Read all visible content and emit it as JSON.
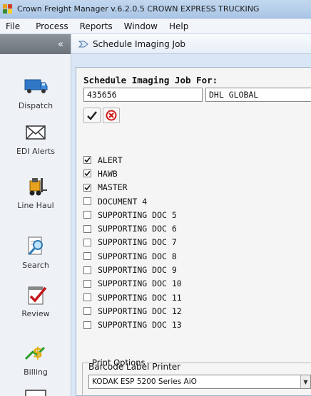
{
  "window": {
    "title": "Crown Freight Manager v.6.2.0.5 CROWN EXPRESS TRUCKING"
  },
  "menu": [
    "File",
    "Process",
    "Reports",
    "Window",
    "Help"
  ],
  "sidebar": {
    "collapse_glyph": "«",
    "items": [
      {
        "label": "Dispatch",
        "icon": "truck-icon"
      },
      {
        "label": "EDI Alerts",
        "icon": "envelope-icon"
      },
      {
        "label": "Line Haul",
        "icon": "forklift-icon"
      },
      {
        "label": "Search",
        "icon": "magnifier-document-icon"
      },
      {
        "label": "Review",
        "icon": "checkmark-document-icon"
      },
      {
        "label": "Billing",
        "icon": "dollar-icon"
      }
    ]
  },
  "tab": {
    "label": "Schedule Imaging Job"
  },
  "form": {
    "heading": "Schedule Imaging Job For:",
    "job_number": "435656",
    "customer": "DHL GLOBAL",
    "confirm_icon": "checkmark-icon",
    "cancel_icon": "cancel-icon"
  },
  "documents": [
    {
      "label": "ALERT",
      "checked": true
    },
    {
      "label": "HAWB",
      "checked": true
    },
    {
      "label": "MASTER",
      "checked": true
    },
    {
      "label": "DOCUMENT 4",
      "checked": false
    },
    {
      "label": "SUPPORTING DOC 5",
      "checked": false
    },
    {
      "label": "SUPPORTING DOC 6",
      "checked": false
    },
    {
      "label": "SUPPORTING DOC 7",
      "checked": false
    },
    {
      "label": "SUPPORTING DOC 8",
      "checked": false
    },
    {
      "label": "SUPPORTING DOC 9",
      "checked": false
    },
    {
      "label": "SUPPORTING DOC 10",
      "checked": false
    },
    {
      "label": "SUPPORTING DOC 11",
      "checked": false
    },
    {
      "label": "SUPPORTING DOC 12",
      "checked": false
    },
    {
      "label": "SUPPORTING DOC 13",
      "checked": false
    }
  ],
  "print_options": {
    "legend": "Print Options",
    "printer_label": "Barcode Label Printer",
    "printer_value": "KODAK ESP 5200 Series AiO"
  },
  "colors": {
    "accent": "#a9c5e6",
    "panel_bg": "#f5f5f5",
    "confirm": "#222222",
    "cancel": "#d11a1a"
  }
}
